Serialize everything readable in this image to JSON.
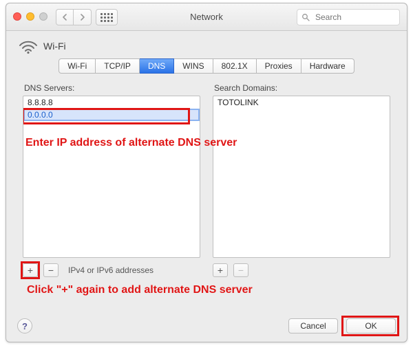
{
  "titlebar": {
    "window_title": "Network",
    "search_placeholder": "Search"
  },
  "header": {
    "service_name": "Wi-Fi"
  },
  "tabs": [
    {
      "id": "wifi",
      "label": "Wi-Fi",
      "active": false
    },
    {
      "id": "tcpip",
      "label": "TCP/IP",
      "active": false
    },
    {
      "id": "dns",
      "label": "DNS",
      "active": true
    },
    {
      "id": "wins",
      "label": "WINS",
      "active": false
    },
    {
      "id": "8021x",
      "label": "802.1X",
      "active": false
    },
    {
      "id": "proxies",
      "label": "Proxies",
      "active": false
    },
    {
      "id": "hw",
      "label": "Hardware",
      "active": false
    }
  ],
  "dns_panel": {
    "label": "DNS Servers:",
    "entries": [
      "8.8.8.8"
    ],
    "editing_value": "0.0.0.0",
    "footer_hint": "IPv4 or IPv6 addresses"
  },
  "search_domains_panel": {
    "label": "Search Domains:",
    "entries": [
      "TOTOLINK"
    ]
  },
  "buttons": {
    "add": "+",
    "remove": "−",
    "help": "?",
    "cancel": "Cancel",
    "ok": "OK"
  },
  "annotations": {
    "line1": "Enter IP address of alternate DNS server",
    "line2": "Click \"+\" again to add alternate DNS server"
  }
}
